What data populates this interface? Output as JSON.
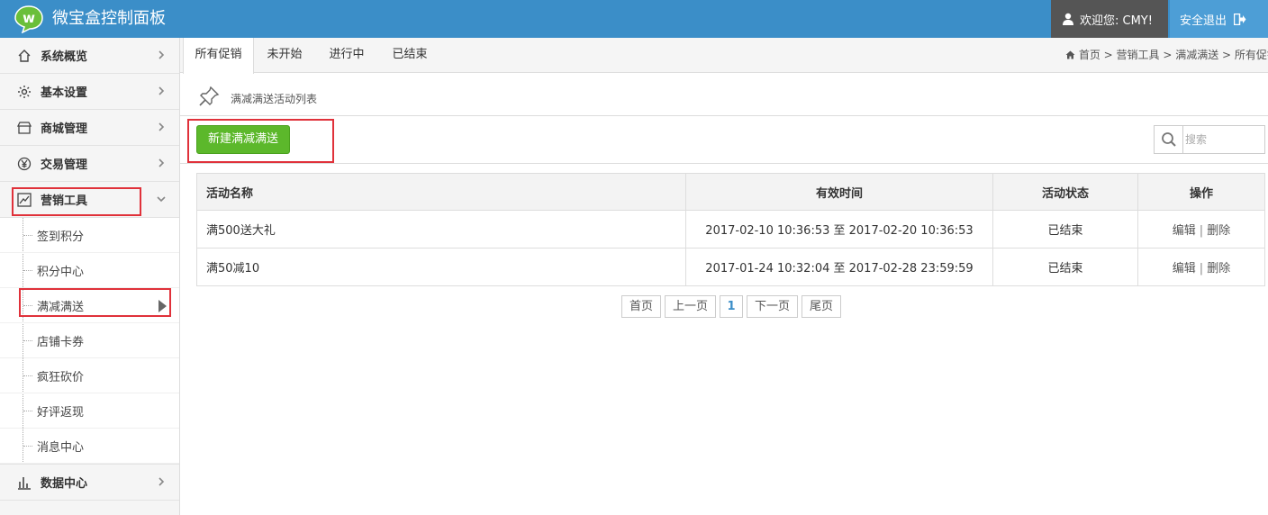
{
  "header": {
    "title": "微宝盒控制面板",
    "welcome": "欢迎您: CMY!",
    "logout": "安全退出",
    "brand_color": "#3b8ec8"
  },
  "sidebar": {
    "menu": [
      {
        "label": "系统概览",
        "icon": "home-icon"
      },
      {
        "label": "基本设置",
        "icon": "gear-icon"
      },
      {
        "label": "商城管理",
        "icon": "store-icon"
      },
      {
        "label": "交易管理",
        "icon": "yen-icon"
      },
      {
        "label": "营销工具",
        "icon": "chart-icon"
      }
    ],
    "submenu": [
      "签到积分",
      "积分中心",
      "满减满送",
      "店铺卡券",
      "疯狂砍价",
      "好评返现",
      "消息中心"
    ],
    "data_center": {
      "label": "数据中心",
      "icon": "bar-chart-icon"
    }
  },
  "tabs": [
    "所有促销",
    "未开始",
    "进行中",
    "已结束"
  ],
  "breadcrumb": "首页 > 营销工具 > 满减满送 > 所有促销",
  "section": {
    "title": "满减满送活动列表"
  },
  "toolbar": {
    "new_button": "新建满减满送",
    "search_placeholder": "搜索",
    "accent_color": "#5cb82b"
  },
  "table": {
    "headers": [
      "活动名称",
      "有效时间",
      "活动状态",
      "操作"
    ],
    "rows": [
      {
        "name": "满500送大礼",
        "time": "2017-02-10 10:36:53 至 2017-02-20 10:36:53",
        "status": "已结束",
        "edit": "编辑",
        "sep": "|",
        "delete": "删除"
      },
      {
        "name": "满50减10",
        "time": "2017-01-24 10:32:04 至 2017-02-28 23:59:59",
        "status": "已结束",
        "edit": "编辑",
        "sep": "|",
        "delete": "删除"
      }
    ]
  },
  "pagination": {
    "first": "首页",
    "prev": "上一页",
    "current": "1",
    "next": "下一页",
    "last": "尾页"
  }
}
